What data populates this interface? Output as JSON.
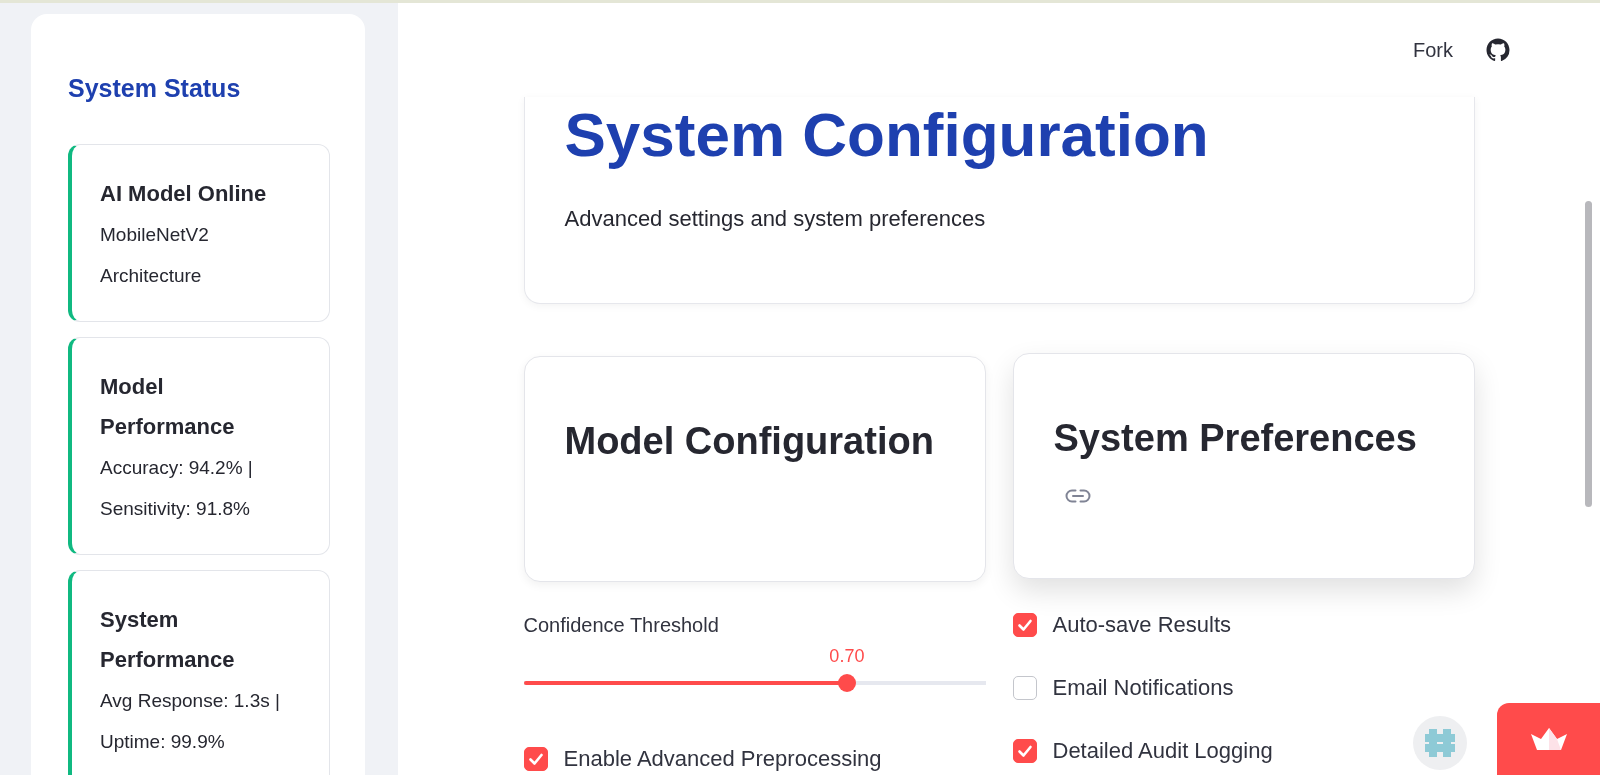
{
  "header": {
    "fork_button": "Fork"
  },
  "sidebar": {
    "title": "System Status",
    "status_cards": [
      {
        "title": "AI Model Online",
        "text": "MobileNetV2 Architecture"
      },
      {
        "title": "Model Performance",
        "text": "Accuracy: 94.2% | Sensitivity: 91.8%"
      },
      {
        "title": "System Performance",
        "text": "Avg Response: 1.3s | Uptime: 99.9%"
      }
    ]
  },
  "page": {
    "title": "System Configuration",
    "subtitle": "Advanced settings and system preferences"
  },
  "sections": [
    {
      "title": "Model Configuration",
      "hovered": false,
      "controls": [
        {
          "kind": "slider",
          "label": "Confidence Threshold",
          "reading": "0.70",
          "level": 0.7
        },
        {
          "kind": "checkbox",
          "label": "Enable Advanced Preprocessing",
          "checked": true
        }
      ]
    },
    {
      "title": "System Preferences",
      "hovered": true,
      "controls": [
        {
          "kind": "checkbox",
          "label": "Auto-save Results",
          "checked": true
        },
        {
          "kind": "checkbox",
          "label": "Email Notifications",
          "checked": false
        },
        {
          "kind": "checkbox",
          "label": "Detailed Audit Logging",
          "checked": true
        }
      ]
    }
  ]
}
